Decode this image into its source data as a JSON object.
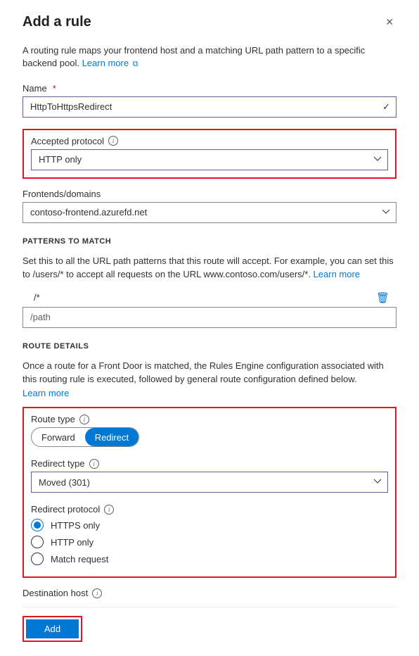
{
  "header": {
    "title": "Add a rule"
  },
  "intro": {
    "text": "A routing rule maps your frontend host and a matching URL path pattern to a specific backend pool. ",
    "learn_more": "Learn more"
  },
  "name": {
    "label": "Name",
    "value": "HttpToHttpsRedirect"
  },
  "accepted_protocol": {
    "label": "Accepted protocol",
    "value": "HTTP only"
  },
  "frontends": {
    "label": "Frontends/domains",
    "value": "contoso-frontend.azurefd.net"
  },
  "patterns": {
    "heading": "PATTERNS TO MATCH",
    "desc": "Set this to all the URL path patterns that this route will accept. For example, you can set this to /users/* to accept all requests on the URL www.contoso.com/users/*. ",
    "learn_more": "Learn more",
    "items": [
      "/*"
    ],
    "placeholder": "/path"
  },
  "route_details": {
    "heading": "ROUTE DETAILS",
    "desc": "Once a route for a Front Door is matched, the Rules Engine configuration associated with this routing rule is executed, followed by general route configuration defined below. ",
    "learn_more": "Learn more"
  },
  "route_type": {
    "label": "Route type",
    "options": {
      "forward": "Forward",
      "redirect": "Redirect"
    }
  },
  "redirect_type": {
    "label": "Redirect type",
    "value": "Moved (301)"
  },
  "redirect_protocol": {
    "label": "Redirect protocol",
    "options": [
      "HTTPS only",
      "HTTP only",
      "Match request"
    ]
  },
  "destination_host": {
    "label": "Destination host"
  },
  "footer": {
    "add": "Add"
  }
}
